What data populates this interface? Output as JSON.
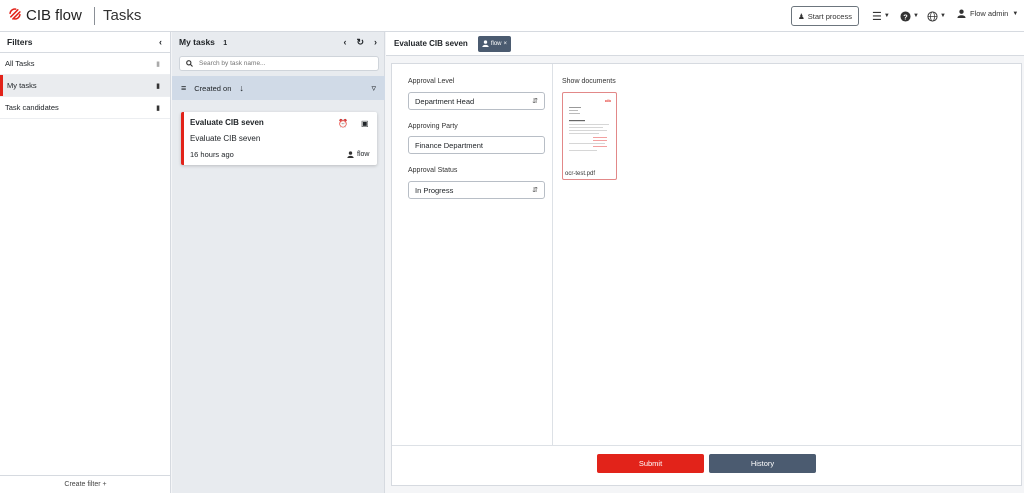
{
  "header": {
    "brand": "CIB flow",
    "app_name": "Tasks",
    "start_process": "Start process",
    "user": "Flow admin"
  },
  "filters": {
    "title": "Filters",
    "items": [
      {
        "label": "All Tasks"
      },
      {
        "label": "My tasks"
      },
      {
        "label": "Task candidates"
      }
    ],
    "create_filter": "Create filter +"
  },
  "tasks": {
    "title": "My tasks",
    "count": "1",
    "search_placeholder": "Search by task name...",
    "sort_label": "Created on",
    "items": [
      {
        "title": "Evaluate CIB seven",
        "name": "Evaluate CIB seven",
        "time": "16 hours ago",
        "assignee": "flow"
      }
    ]
  },
  "detail": {
    "title": "Evaluate CIB seven",
    "assignee_chip": "flow",
    "fields": {
      "approval_level_label": "Approval Level",
      "approval_level_value": "Department Head",
      "approving_party_label": "Approving Party",
      "approving_party_value": "Finance Department",
      "approval_status_label": "Approval Status",
      "approval_status_value": "In Progress"
    },
    "documents_label": "Show documents",
    "document_name": "ocr-test.pdf",
    "submit": "Submit",
    "history": "History"
  },
  "colors": {
    "accent": "#e2231a",
    "secondary": "#4b5b70"
  }
}
